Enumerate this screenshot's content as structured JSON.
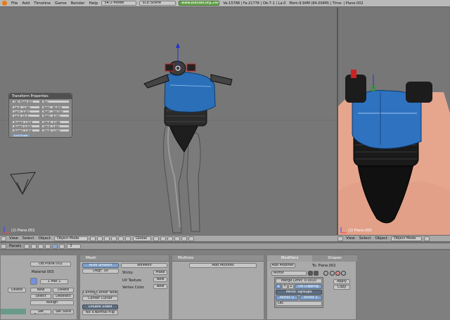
{
  "topbar": {
    "menus": [
      "File",
      "Add",
      "Timeline",
      "Game",
      "Render",
      "Help"
    ],
    "screen": "SR:2-Model",
    "scene": "SCE:Scene",
    "url": "www.blender.org 2492",
    "stats": "Ve:15788 | Fa:21776 | Ob:7-1 | La:0",
    "mem": "Mem:9.94M (84.004M) | Time: | Plane.002"
  },
  "viewport_left": {
    "label": "(2) Plane.002",
    "menus": [
      "View",
      "Select",
      "Object"
    ],
    "mode": "Object Mode",
    "shading": "Global"
  },
  "viewport_right": {
    "label": "(2) Plane.000",
    "menus": [
      "View",
      "Select",
      "Object"
    ],
    "mode": "Object Mode"
  },
  "transform": {
    "title": "Transform Properties",
    "ob_name": "OB: Plane.002",
    "par": "Par:",
    "loc": [
      "LocX: -1.061",
      "LocY: -0.001",
      "LocZ: 10.0..."
    ],
    "rot": [
      "RotX: -90.000",
      "RotY: -180.000",
      "RotZ: -0.000"
    ],
    "scale": [
      "ScaleX: 1.000",
      "ScaleY: 1.000",
      "ScaleZ: 1.000"
    ],
    "dim": [
      "DimX: 3.288",
      "DimY: 1.000",
      "DimZ: 1.000"
    ],
    "link_scale": "Link Scale"
  },
  "buttons_header": {
    "menus": [
      "Panels"
    ],
    "frame": "2"
  },
  "link_panel": {
    "ob": "OB:Plane.002",
    "material": "Material 003",
    "mat_index": "1 Mat 1",
    "delete": "Delete",
    "new": "New",
    "delete2": "Delete",
    "select": "Select",
    "deselect": "Deselect",
    "assign": "Assign",
    "set_smooth": "Set Smooth",
    "set_solid": "Set Solid"
  },
  "mesh_panel": {
    "title": "Mesh",
    "auto_smooth": "Auto Smooth",
    "degr": "Degr: 30",
    "texmesh": "TexMesh",
    "sticky": "Sticky",
    "make": "Make",
    "uv_texture": "UV Texture",
    "new1": "New",
    "vertex_color": "Vertex Color",
    "new2": "New",
    "center": "Center",
    "center_new": "Center New",
    "center_cursor": "Center Cursor",
    "double_sided": "Double Sided",
    "no_vnormal_flip": "No V.Normal Flip"
  },
  "multires_panel": {
    "title": "Multires",
    "add": "Add Multires"
  },
  "modifiers_panel": {
    "tab_modifiers": "Modifiers",
    "tab_shapes": "Shapes",
    "add_modifier": "Add Modifier",
    "to": "To: Plane.002",
    "mod_name": "Mirror",
    "merge": "Merge Limit: 0.0010",
    "x": "X",
    "y": "Y",
    "z": "Z",
    "do_clipping": "Do Clipping",
    "mirror_vgroups": "Mirror Vgroups",
    "mirror_u": "Mirror U",
    "mirror_v": "Mirror V",
    "ob": "Ob:",
    "apply": "Apply",
    "copy": "Copy"
  }
}
